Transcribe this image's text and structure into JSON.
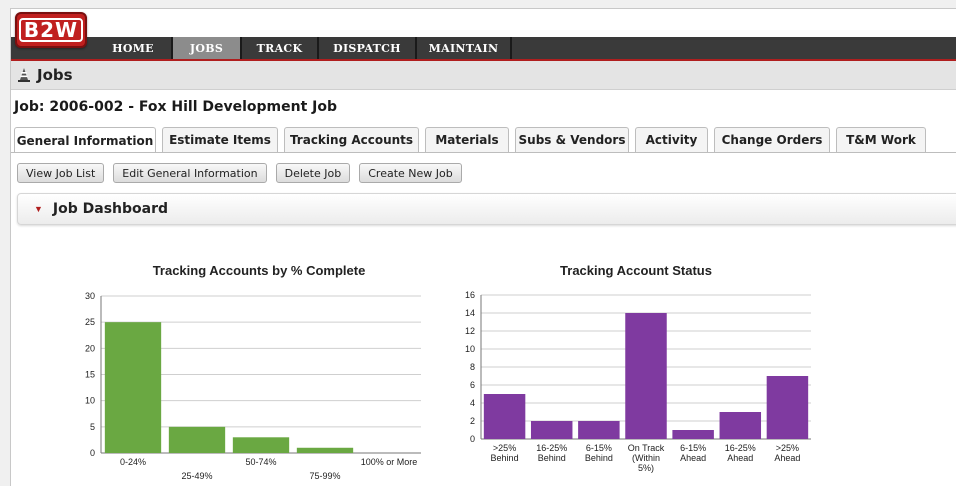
{
  "app": {
    "logo_text": "B2W"
  },
  "nav": {
    "items": [
      {
        "label": "HOME",
        "active": false
      },
      {
        "label": "JOBS",
        "active": true
      },
      {
        "label": "TRACK",
        "active": false
      },
      {
        "label": "DISPATCH",
        "active": false
      },
      {
        "label": "MAINTAIN",
        "active": false
      }
    ]
  },
  "section": {
    "title": "Jobs"
  },
  "job": {
    "title": "Job: 2006-002 - Fox Hill Development Job"
  },
  "tabs": [
    {
      "label": "General Information",
      "active": true
    },
    {
      "label": "Estimate Items",
      "active": false
    },
    {
      "label": "Tracking Accounts",
      "active": false
    },
    {
      "label": "Materials",
      "active": false
    },
    {
      "label": "Subs & Vendors",
      "active": false
    },
    {
      "label": "Activity",
      "active": false
    },
    {
      "label": "Change Orders",
      "active": false
    },
    {
      "label": "T&M Work",
      "active": false
    }
  ],
  "actions": [
    {
      "label": "View Job List"
    },
    {
      "label": "Edit General Information"
    },
    {
      "label": "Delete Job"
    },
    {
      "label": "Create New Job"
    }
  ],
  "dashboard": {
    "title": "Job Dashboard"
  },
  "colors": {
    "nav_bg": "#3a3a3a",
    "accent_red": "#b01e1e",
    "green_bar": "#6aa842",
    "purple_bar": "#7f3aa0"
  },
  "chart_data": [
    {
      "type": "bar",
      "title": "Tracking Accounts by % Complete",
      "categories": [
        "0-24%",
        "25-49%",
        "50-74%",
        "75-99%",
        "100% or More"
      ],
      "values": [
        25,
        5,
        3,
        1,
        0
      ],
      "ylim": [
        0,
        30
      ],
      "yticks": [
        0,
        5,
        10,
        15,
        20,
        25,
        30
      ],
      "color": "#6aa842",
      "grid": true,
      "legend": "none"
    },
    {
      "type": "bar",
      "title": "Tracking Account Status",
      "categories": [
        ">25% Behind",
        "16-25% Behind",
        "6-15% Behind",
        "On Track (Within 5%)",
        "6-15% Ahead",
        "16-25% Ahead",
        ">25% Ahead"
      ],
      "category_lines": [
        [
          ">25%",
          "Behind"
        ],
        [
          "16-25%",
          "Behind"
        ],
        [
          "6-15%",
          "Behind"
        ],
        [
          "On Track",
          "(Within",
          "5%)"
        ],
        [
          "6-15%",
          "Ahead"
        ],
        [
          "16-25%",
          "Ahead"
        ],
        [
          ">25%",
          "Ahead"
        ]
      ],
      "values": [
        5,
        2,
        2,
        14,
        1,
        3,
        7
      ],
      "ylim": [
        0,
        16
      ],
      "yticks": [
        0,
        2,
        4,
        6,
        8,
        10,
        12,
        14,
        16
      ],
      "color": "#7f3aa0",
      "grid": true,
      "legend": "none"
    }
  ]
}
